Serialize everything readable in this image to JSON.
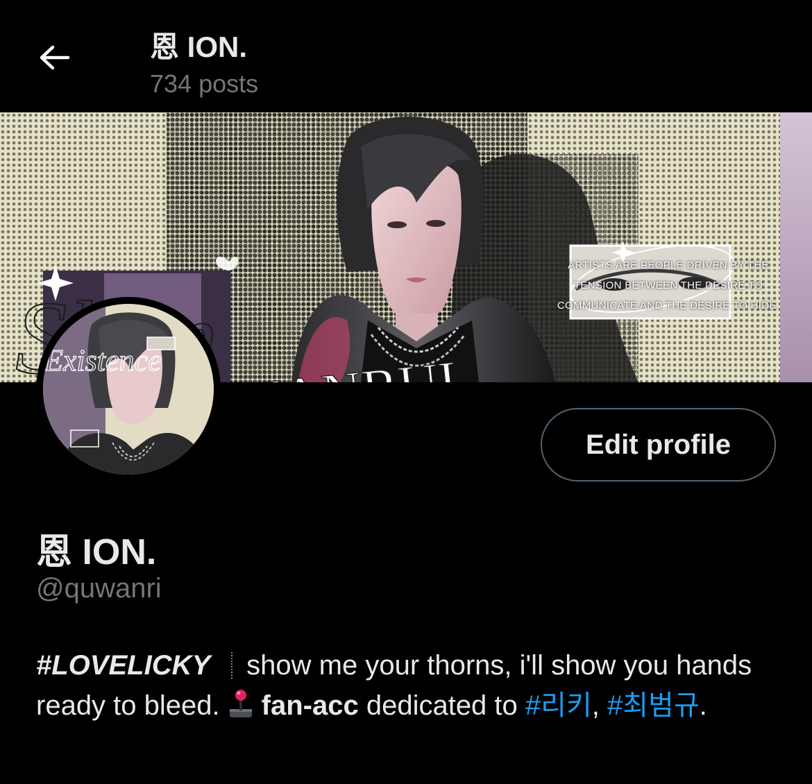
{
  "header": {
    "title": "恩 ION.",
    "post_count": "734 posts"
  },
  "banner": {
    "script_text": "Shen",
    "script_suffix": "ɴ",
    "name_art": "QUANRUI",
    "quote": "ARTISTS ARE PEOPLE DRIVEN BY THE TENSION BETWEEN THE DESIRE TO COMMUNICATE AND THE DESIRE TO HIDE.",
    "avatar_art_text": "Existence"
  },
  "profile": {
    "edit_button": "Edit profile",
    "display_name": "恩 ION.",
    "handle": "@quwanri"
  },
  "bio": {
    "hashtag_main": "#LOVELICKY",
    "text_1": "show me your thorns, i'll show you hands ready to bleed.",
    "emoji": "joystick-icon",
    "fan_acc": "fan-acc",
    "text_2": "dedicated to",
    "tag_1": "#리키",
    "comma": ",",
    "tag_2": "#최범규",
    "period": "."
  },
  "colors": {
    "background": "#000000",
    "text_primary": "#e7e9ea",
    "text_secondary": "#71767b",
    "link": "#1d9bf0",
    "button_border": "#536471",
    "banner_cream": "#e6e2c6",
    "banner_lilac": "#b9a7c7"
  }
}
